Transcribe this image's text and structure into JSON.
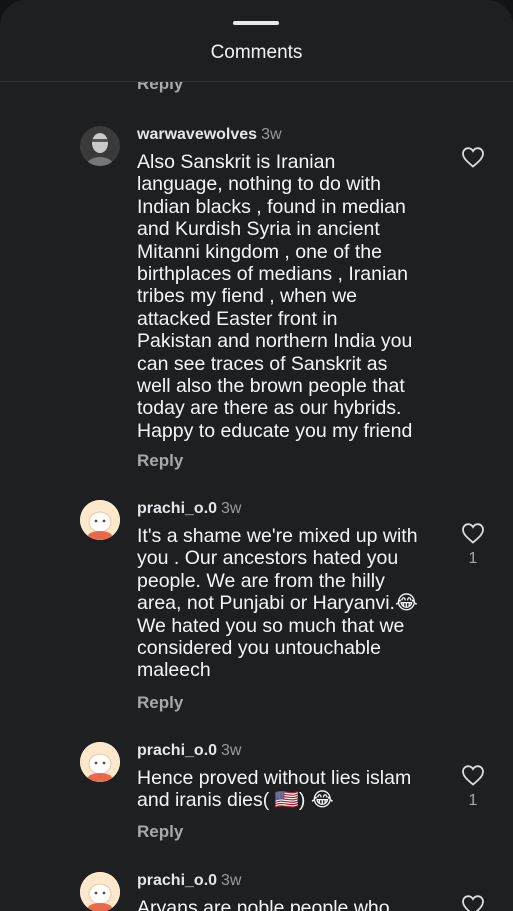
{
  "header": {
    "title": "Comments"
  },
  "top_reply": {
    "label": "Reply"
  },
  "comments": [
    {
      "username": "warwavewolves",
      "time": "3w",
      "text": "Also Sanskrit is Iranian\nlanguage, nothing to do with\nIndian blacks , found in median\nand Kurdish Syria in ancient\nMitanni kingdom , one of the\nbirthplaces of medians , Iranian\ntribes my fiend , when we\nattacked Easter front in\nPakistan and northern India you\ncan see traces of Sanskrit as\nwell also the brown people that\ntoday are there as our hybrids.\nHappy to educate you my friend",
      "reply_label": "Reply",
      "like_count": ""
    },
    {
      "username": "prachi_o.0",
      "time": "3w",
      "text": "It's a shame we're mixed up with\nyou . Our ancestors hated you\npeople. We are from the hilly\narea, not Punjabi or Haryanvi.😂\nWe hated you so much that we\nconsidered you untouchable\nmaleech",
      "reply_label": "Reply",
      "like_count": "1"
    },
    {
      "username": "prachi_o.0",
      "time": "3w",
      "text": "Hence proved without lies islam\nand iranis dies( 🇺🇸) 😂",
      "reply_label": "Reply",
      "like_count": "1"
    },
    {
      "username": "prachi_o.0",
      "time": "3w",
      "text": "Aryans are noble people who",
      "reply_label": "",
      "like_count": ""
    }
  ],
  "icons": {
    "like": "heart-outline-icon"
  },
  "colors": {
    "background": "#1d1f21",
    "text": "#f5f5f5",
    "muted": "#a8a8a8"
  }
}
